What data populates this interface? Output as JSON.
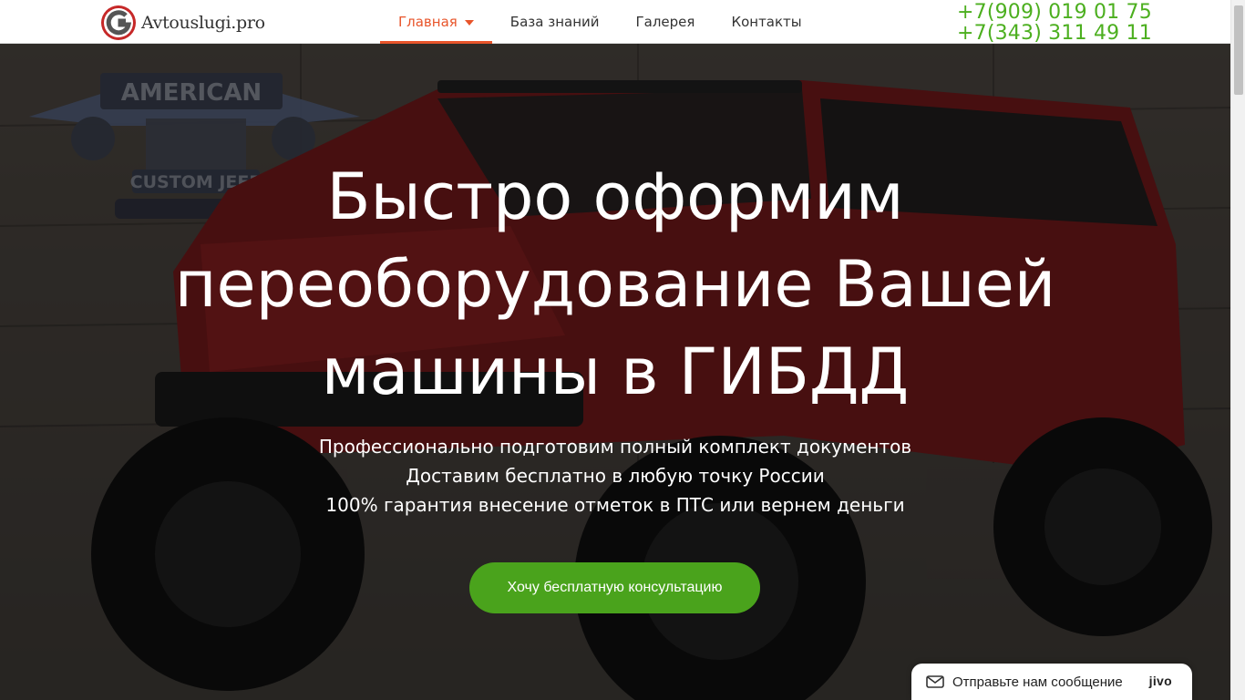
{
  "header": {
    "logo_text": "Avtouslugi.pro",
    "nav": [
      {
        "label": "Главная",
        "active": true
      },
      {
        "label": "База знаний"
      },
      {
        "label": "Галерея"
      },
      {
        "label": "Контакты"
      }
    ],
    "phones": [
      "+7(909) 019 01 75",
      "+7(343) 311 49 11"
    ]
  },
  "hero": {
    "title": "Быстро оформим переоборудование Вашей машины в ГИБДД",
    "points": [
      "Профессионально подготовим полный комплект документов",
      "Доставим бесплатно в любую точку России",
      "100% гарантия внесение отметок в ПТС или вернем деньги"
    ],
    "cta_label": "Хочу бесплатную консультацию",
    "background_sign": {
      "line1": "AMERICAN",
      "line2": "CUSTOM JEEP"
    }
  },
  "chat": {
    "label": "Отправьте нам сообщение",
    "brand": "jivo"
  },
  "colors": {
    "accent": "#e8552b",
    "phone": "#4caf1f",
    "cta": "#4aa31c"
  }
}
